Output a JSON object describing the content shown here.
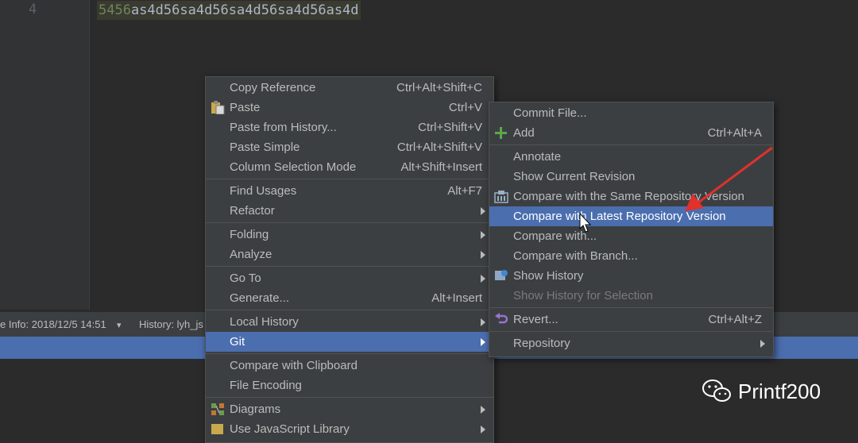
{
  "editor": {
    "line_number": "4",
    "code_highlight": "5456",
    "code_rest": "as4d56sa4d56sa4d56sa4d56as4d"
  },
  "statusbar": {
    "info": "e Info: 2018/12/5 14:51",
    "dropdown": "▾",
    "history": "History: lyh_js"
  },
  "context_menu": {
    "items": [
      {
        "label": "Copy Reference",
        "shortcut": "Ctrl+Alt+Shift+C"
      },
      {
        "label": "Paste",
        "shortcut": "Ctrl+V",
        "icon": "paste-icon"
      },
      {
        "label": "Paste from History...",
        "shortcut": "Ctrl+Shift+V"
      },
      {
        "label": "Paste Simple",
        "shortcut": "Ctrl+Alt+Shift+V"
      },
      {
        "label": "Column Selection Mode",
        "shortcut": "Alt+Shift+Insert"
      },
      {
        "label": "Find Usages",
        "shortcut": "Alt+F7"
      },
      {
        "label": "Refactor",
        "submenu": true
      },
      {
        "label": "Folding",
        "submenu": true
      },
      {
        "label": "Analyze",
        "submenu": true
      },
      {
        "label": "Go To",
        "submenu": true
      },
      {
        "label": "Generate...",
        "shortcut": "Alt+Insert"
      },
      {
        "label": "Local History",
        "submenu": true
      },
      {
        "label": "Git",
        "submenu": true,
        "selected": true
      },
      {
        "label": "Compare with Clipboard"
      },
      {
        "label": "File Encoding"
      },
      {
        "label": "Diagrams",
        "submenu": true,
        "icon": "diagrams-icon"
      },
      {
        "label": "Use JavaScript Library",
        "submenu": true
      }
    ]
  },
  "git_menu": {
    "items": [
      {
        "label": "Commit File..."
      },
      {
        "label": "Add",
        "shortcut": "Ctrl+Alt+A",
        "icon": "plus-icon"
      },
      {
        "label": "Annotate"
      },
      {
        "label": "Show Current Revision"
      },
      {
        "label": "Compare with the Same Repository Version",
        "icon": "compare-icon"
      },
      {
        "label": "Compare with Latest Repository Version",
        "selected": true
      },
      {
        "label": "Compare with..."
      },
      {
        "label": "Compare with Branch..."
      },
      {
        "label": "Show History",
        "icon": "history-icon"
      },
      {
        "label": "Show History for Selection",
        "disabled": true
      },
      {
        "label": "Revert...",
        "shortcut": "Ctrl+Alt+Z",
        "icon": "revert-icon"
      },
      {
        "label": "Repository",
        "submenu": true
      }
    ]
  },
  "watermark": {
    "text": "Printf200"
  },
  "colors": {
    "editor_bg": "#2b2b2b",
    "menu_bg": "#3c3f41",
    "selection": "#4b6eaf",
    "annotation_arrow": "#e0312b"
  }
}
